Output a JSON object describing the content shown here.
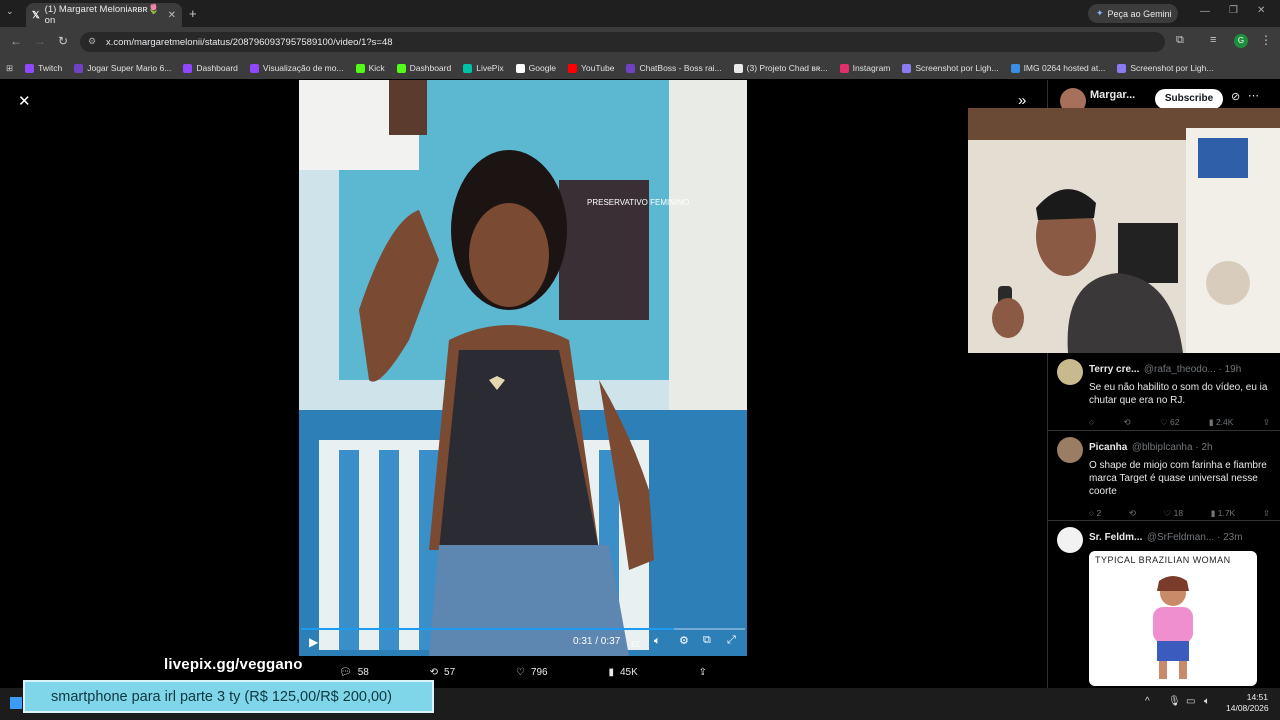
{
  "browser": {
    "tab_title": "(1) Margaret Meloniᴀʀʙʀ🌷 on",
    "new_tab": "+",
    "url": "x.com/margaretmelonii/status/2087960937957589100/video/1?s=48",
    "gemini_button": "Peça ao Gemini",
    "avatar_letter": "G",
    "bookmarks": [
      "Twitch",
      "Jogar Super Mario 6...",
      "Dashboard",
      "Visualização de mo...",
      "Kick",
      "Dashboard",
      "LivePix",
      "Google",
      "YouTube",
      "ChatBoss - Boss rai...",
      "(3) Projeto Chad ʙʀ...",
      "Instagram",
      "Screenshot por Ligh...",
      "IMG 0264 hosted at...",
      "Screenshot por Ligh..."
    ],
    "bookmark_colors": [
      "#9146ff",
      "#6f42c1",
      "#9146ff",
      "#9146ff",
      "#53fc18",
      "#53fc18",
      "#00c2a8",
      "#ffffff",
      "#ff0000",
      "#6f42c1",
      "#e7e9ea",
      "#e1306c",
      "#8a7cf0",
      "#3a8ee6",
      "#8a7cf0"
    ]
  },
  "video": {
    "time": "0:31 / 0:37",
    "progress": 0.84,
    "sign_text": "PRESERVATIVO FEMININO"
  },
  "video_actions": {
    "replies": "58",
    "reposts": "57",
    "likes": "796",
    "views": "45K"
  },
  "profile": {
    "name": "Margar...",
    "subscribe": "Subscribe"
  },
  "tweets": [
    {
      "name": "Terry cre...",
      "handle": "@rafa_theodo... · 19h",
      "text": "Se eu não habilito o som do vídeo, eu ia chutar que era no RJ.",
      "reposts": "",
      "likes": "62",
      "views": "2.4K"
    },
    {
      "name": "Picanha",
      "handle": "@blbiplcanha · 2h",
      "text": "O shape de miojo com farinha e fiambre marca Target é quase universal nesse coorte",
      "replies": "2",
      "likes": "18",
      "views": "1.7K"
    },
    {
      "name": "Sr. Feldm...",
      "handle": "@SrFeldman... · 23m",
      "image_title": "TYPICAL BRAZILIAN WOMAN"
    }
  ],
  "overlay": {
    "livepix": "livepix.gg/veggano",
    "donation": "smartphone para irl parte 3 ty (R$ 125,00/R$ 200,00)"
  },
  "taskbar": {
    "time": "14:51",
    "date": "14/08/2026"
  },
  "colors": {
    "accent": "#1d9bf0",
    "donation_bg": "#7fd6e8"
  }
}
